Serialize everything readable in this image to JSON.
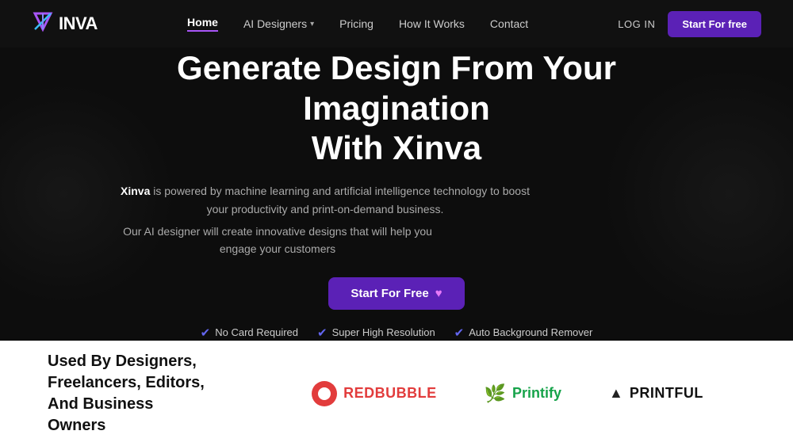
{
  "nav": {
    "logo_text": "INVA",
    "links": [
      {
        "label": "Home",
        "active": true
      },
      {
        "label": "AI Designers",
        "dropdown": true
      },
      {
        "label": "Pricing"
      },
      {
        "label": "How It Works"
      },
      {
        "label": "Contact"
      }
    ],
    "login_label": "LOG IN",
    "cta_label": "Start For free"
  },
  "hero": {
    "title_line1": "Generate Design From Your Imagination",
    "title_line2": "With Xinva",
    "sub1_prefix": "Xinva",
    "sub1_suffix": " is powered by machine learning and artificial intelligence technology to boost your productivity and print-on-demand business.",
    "sub2": "Our AI designer will create innovative designs that will help you engage your customers",
    "cta_label": "Start For Free",
    "badges": [
      {
        "label": "No Card Required",
        "color": "indigo"
      },
      {
        "label": "Super High Resolution",
        "color": "indigo"
      },
      {
        "label": "Auto Background Remover",
        "color": "indigo"
      }
    ]
  },
  "bottom": {
    "title": "Used By Designers, Freelancers, Editors, And Business Owners",
    "brands": [
      {
        "name": "REDBUBBLE"
      },
      {
        "name": "Printify"
      },
      {
        "name": "PRINTFUL"
      }
    ]
  }
}
